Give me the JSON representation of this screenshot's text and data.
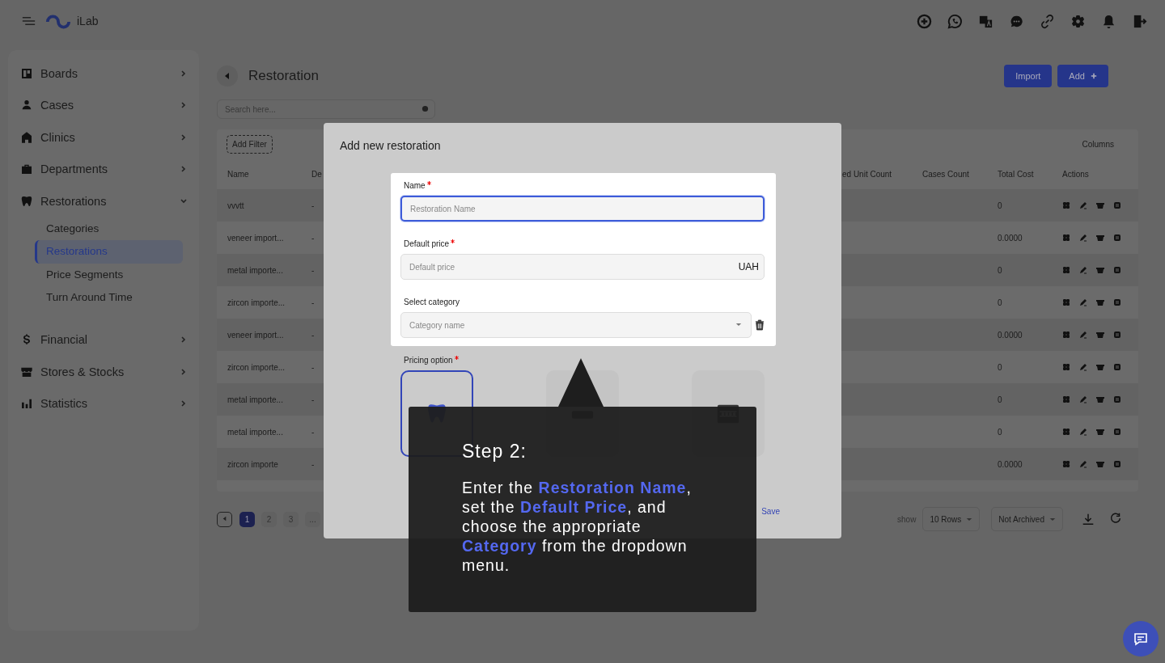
{
  "header": {
    "brand": "iLab"
  },
  "sidebar": {
    "items": [
      {
        "label": "Boards",
        "expanded": false
      },
      {
        "label": "Cases",
        "expanded": false
      },
      {
        "label": "Clinics",
        "expanded": false
      },
      {
        "label": "Departments",
        "expanded": false
      },
      {
        "label": "Restorations",
        "expanded": true,
        "children": [
          {
            "label": "Categories",
            "selected": false
          },
          {
            "label": "Restorations",
            "selected": true
          },
          {
            "label": "Price Segments",
            "selected": false
          },
          {
            "label": "Turn Around Time",
            "selected": false
          }
        ]
      },
      {
        "label": "Financial",
        "expanded": false
      },
      {
        "label": "Stores & Stocks",
        "expanded": false
      },
      {
        "label": "Statistics",
        "expanded": false
      }
    ]
  },
  "page": {
    "title": "Restoration",
    "buttons": [
      "Import",
      "Add"
    ],
    "search": {
      "placeholder": "Search here..."
    }
  },
  "table": {
    "filter_button": "Add Filter",
    "columns_button": "Columns",
    "columns": [
      "Name",
      "De",
      "ed Unit Count",
      "Cases Count",
      "Total Cost",
      "Actions"
    ],
    "rows": [
      {
        "name": "vvvtt",
        "column_2": "-",
        "total_cost": "0"
      },
      {
        "name": "veneer import...",
        "column_2": "-",
        "total_cost": "0.0000"
      },
      {
        "name": "metal importe...",
        "column_2": "-",
        "total_cost": "0"
      },
      {
        "name": "zircon importe...",
        "column_2": "-",
        "total_cost": "0"
      },
      {
        "name": "veneer import...",
        "column_2": "-",
        "total_cost": "0.0000"
      },
      {
        "name": "zircon importe...",
        "column_2": "-",
        "total_cost": "0"
      },
      {
        "name": "metal importe...",
        "column_2": "-",
        "total_cost": "0"
      },
      {
        "name": "metal importe...",
        "column_2": "-",
        "total_cost": "0"
      },
      {
        "name": "zircon importe",
        "column_2": "-",
        "total_cost": "0.0000"
      }
    ]
  },
  "pagination": {
    "pages": [
      {
        "label": "1",
        "selected": true
      },
      {
        "label": "2",
        "selected": false
      },
      {
        "label": "3",
        "selected": false
      },
      {
        "label": "...",
        "selected": false
      }
    ],
    "show_label": "show",
    "rows_select": "10 Rows",
    "archive_select": "Not Archived"
  },
  "modal": {
    "title": "Add new restoration",
    "name_field": {
      "label": "Name",
      "required": true,
      "placeholder": "Restoration Name"
    },
    "price_field": {
      "label": "Default price",
      "required": true,
      "placeholder": "Default price",
      "suffix": "UAH"
    },
    "category_field": {
      "label": "Select category",
      "placeholder": "Category name"
    },
    "pricing": {
      "label": "Pricing option",
      "required": true,
      "options": [
        {
          "selected": true
        },
        {
          "selected": false
        },
        {
          "selected": false
        }
      ]
    },
    "save": "Save"
  },
  "tooltip": {
    "title": "Step 2:",
    "text": "Enter the **Restoration Name**, set the **Default Price**, and choose the appropriate **Category** from the dropdown menu."
  }
}
